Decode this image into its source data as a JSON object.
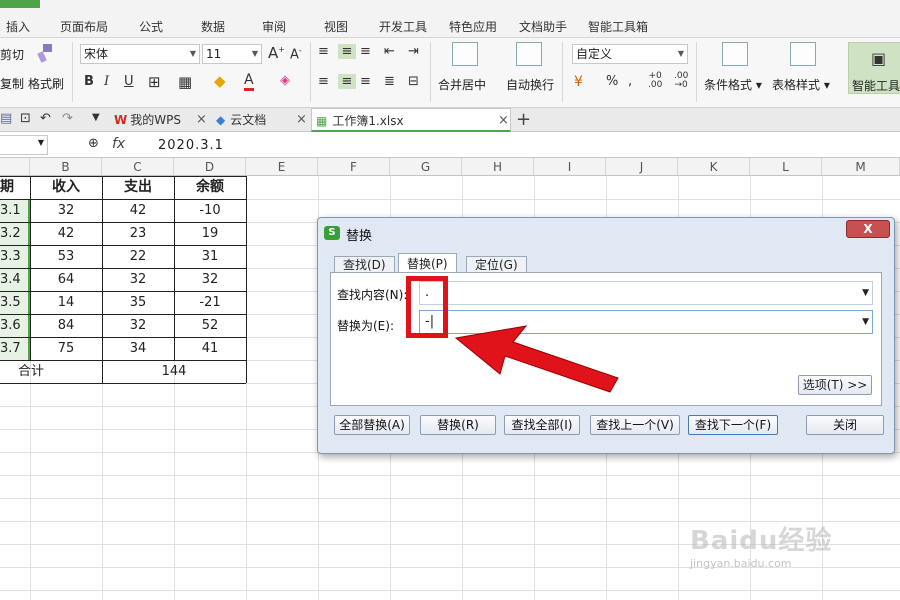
{
  "menu": {
    "items": [
      "插入",
      "页面布局",
      "公式",
      "数据",
      "审阅",
      "视图",
      "开发工具",
      "特色应用",
      "文档助手",
      "智能工具箱"
    ]
  },
  "ribbon": {
    "cut": "剪切",
    "copy": "复制",
    "format_painter": "格式刷",
    "font_name": "宋体",
    "font_size": "11",
    "bold": "B",
    "italic": "I",
    "underline": "U",
    "merge_center": "合并居中",
    "auto_wrap": "自动换行",
    "number_format": "自定义",
    "percent": "%",
    "conditional_format": "条件格式",
    "table_style": "表格样式",
    "smart_tools": "智能工具"
  },
  "tabs": {
    "wps": "我的WPS",
    "cloud": "云文档",
    "workbook": "工作簿1.xlsx",
    "close": "×",
    "add": "+"
  },
  "formula_bar": {
    "fx": "fx",
    "value": "2020.3.1"
  },
  "columns": [
    "B",
    "C",
    "D",
    "E",
    "F",
    "G",
    "H",
    "I",
    "J",
    "K",
    "L",
    "M"
  ],
  "table": {
    "headers": [
      "期",
      "收入",
      "支出",
      "余额"
    ],
    "rows": [
      [
        "3.1",
        "32",
        "42",
        "-10"
      ],
      [
        "3.2",
        "42",
        "23",
        "19"
      ],
      [
        "3.3",
        "53",
        "22",
        "31"
      ],
      [
        "3.4",
        "64",
        "32",
        "32"
      ],
      [
        "3.5",
        "14",
        "35",
        "-21"
      ],
      [
        "3.6",
        "84",
        "32",
        "52"
      ],
      [
        "3.7",
        "75",
        "34",
        "41"
      ]
    ],
    "total_label": "合计",
    "total_value": "144"
  },
  "dialog": {
    "title": "替换",
    "close": "X",
    "tab_find": "查找(D)",
    "tab_replace": "替换(P)",
    "tab_goto": "定位(G)",
    "find_label": "查找内容(N):",
    "find_value": ".",
    "replace_label": "替换为(E):",
    "replace_value": "-|",
    "options": "选项(T) >>",
    "replace_all": "全部替换(A)",
    "replace": "替换(R)",
    "find_all": "查找全部(I)",
    "find_prev": "查找上一个(V)",
    "find_next": "查找下一个(F)",
    "close_btn": "关闭"
  },
  "watermark": {
    "brand": "Baidu经验",
    "url": "jingyan.baidu.com"
  },
  "colors": {
    "accent_green": "#4fa44a",
    "annotation_red": "#e0121a"
  }
}
